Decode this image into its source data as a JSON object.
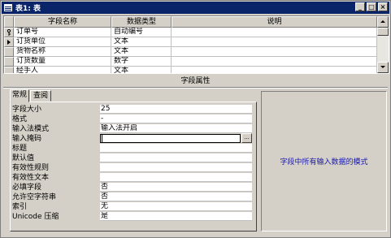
{
  "window": {
    "title": "表1: 表",
    "btn_minimize": "_",
    "btn_maximize": "□",
    "btn_close": "×"
  },
  "grid": {
    "headers": {
      "name": "字段名称",
      "type": "数据类型",
      "desc": "说明"
    },
    "rows": [
      {
        "name": "订单号",
        "type": "自动编号",
        "desc": "",
        "selector": "key"
      },
      {
        "name": "订货单位",
        "type": "文本",
        "desc": "",
        "selector": "current"
      },
      {
        "name": "货物名称",
        "type": "文本",
        "desc": "",
        "selector": ""
      },
      {
        "name": "订货数量",
        "type": "数字",
        "desc": "",
        "selector": ""
      },
      {
        "name": "经手人",
        "type": "文本",
        "desc": "",
        "selector": ""
      }
    ]
  },
  "section": {
    "title": "字段属性"
  },
  "tabs": {
    "general": "常规",
    "lookup": "查阅",
    "active": "general"
  },
  "properties": [
    {
      "label": "字段大小",
      "value": "25"
    },
    {
      "label": "格式",
      "value": "-"
    },
    {
      "label": "输入法模式",
      "value": "输入法开启"
    },
    {
      "label": "输入掩码",
      "value": ""
    },
    {
      "label": "标题",
      "value": ""
    },
    {
      "label": "默认值",
      "value": ""
    },
    {
      "label": "有效性规则",
      "value": ""
    },
    {
      "label": "有效性文本",
      "value": ""
    },
    {
      "label": "必填字段",
      "value": "否"
    },
    {
      "label": "允许空字符串",
      "value": "否"
    },
    {
      "label": "索引",
      "value": "无"
    },
    {
      "label": "Unicode 压缩",
      "value": "是"
    }
  ],
  "builder_button": "...",
  "help": {
    "text": "字段中所有输入数据的模式"
  }
}
